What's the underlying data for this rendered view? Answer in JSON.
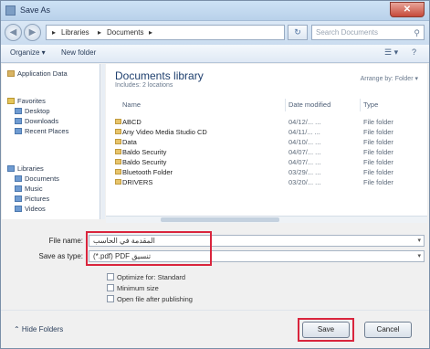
{
  "window": {
    "title": "Save As",
    "close_glyph": "✕"
  },
  "nav": {
    "back_glyph": "◀",
    "fwd_glyph": "▶",
    "refresh_glyph": "↻"
  },
  "address": {
    "crumbs": [
      "▸",
      "Libraries",
      "▸",
      "Documents",
      "▸"
    ],
    "search_placeholder": "Search Documents"
  },
  "toolbar": {
    "organize": "Organize ▾",
    "new_folder": "New folder",
    "view_glyph": "☰ ▾",
    "help_glyph": "?"
  },
  "sidebar": {
    "items": [
      {
        "label": "Application Data",
        "icon": "folder"
      },
      {
        "label": "Favorites",
        "icon": "star"
      },
      {
        "label": "Desktop",
        "icon": "desktop"
      },
      {
        "label": "Downloads",
        "icon": "downloads"
      },
      {
        "label": "Recent Places",
        "icon": "recent"
      },
      {
        "label": "Libraries",
        "icon": "library"
      },
      {
        "label": "Documents",
        "icon": "documents"
      },
      {
        "label": "Music",
        "icon": "music"
      },
      {
        "label": "Pictures",
        "icon": "pictures"
      },
      {
        "label": "Videos",
        "icon": "videos"
      }
    ]
  },
  "library": {
    "title": "Documents library",
    "subtitle": "Includes: 2 locations",
    "arrange": "Arrange by: Folder ▾"
  },
  "columns": {
    "name": "Name",
    "date": "Date modified",
    "type": "Type"
  },
  "files": [
    {
      "name": "ABCD",
      "date": "04/12/... ...",
      "type": "File folder"
    },
    {
      "name": "Any Video Media Studio CD",
      "date": "04/11/... ...",
      "type": "File folder"
    },
    {
      "name": "Data",
      "date": "04/10/... ...",
      "type": "File folder"
    },
    {
      "name": "Baldo Security",
      "date": "04/07/... ...",
      "type": "File folder"
    },
    {
      "name": "Baldo Security",
      "date": "04/07/... ...",
      "type": "File folder"
    },
    {
      "name": "Bluetooth Folder",
      "date": "03/29/... ...",
      "type": "File folder"
    },
    {
      "name": "DRIVERS",
      "date": "03/20/... ...",
      "type": "File folder"
    }
  ],
  "form": {
    "file_name_label": "File name:",
    "file_name_value": "المقدمة في الحاسب",
    "save_type_label": "Save as type:",
    "save_type_value": "(*.pdf) PDF تنسيق",
    "options": [
      "Optimize for: Standard",
      "Minimum size",
      "Open file after publishing"
    ]
  },
  "bottom": {
    "hide_folders": "⌃ Hide Folders",
    "save": "Save",
    "cancel": "Cancel"
  },
  "colors": {
    "highlight": "#d9253d",
    "title_text": "#1e3f6e"
  }
}
